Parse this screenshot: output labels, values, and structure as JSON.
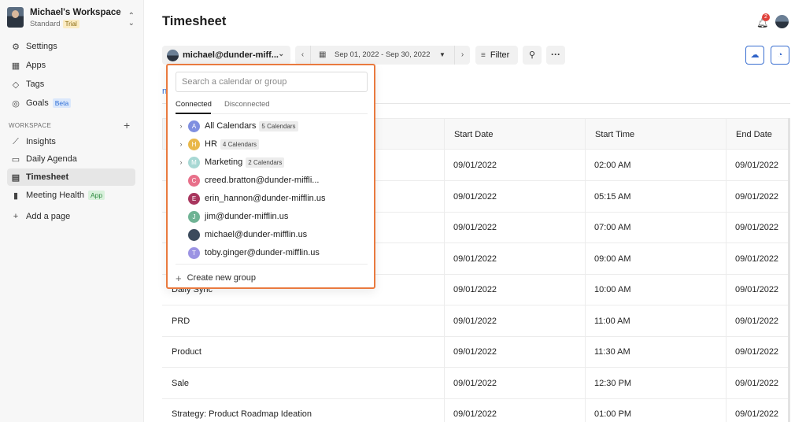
{
  "workspace": {
    "name": "Michael's Workspace",
    "plan": "Standard",
    "trial_badge": "Trial"
  },
  "sidebar": {
    "top_items": [
      {
        "label": "Settings",
        "icon": "gear-icon"
      },
      {
        "label": "Apps",
        "icon": "grid-icon"
      },
      {
        "label": "Tags",
        "icon": "tag-icon"
      },
      {
        "label": "Goals",
        "icon": "target-icon",
        "badge": "Beta"
      }
    ],
    "section_label": "WORKSPACE",
    "items": [
      {
        "label": "Insights",
        "icon": "chart-line-icon"
      },
      {
        "label": "Daily Agenda",
        "icon": "agenda-icon"
      },
      {
        "label": "Timesheet",
        "icon": "table-icon",
        "active": true
      },
      {
        "label": "Meeting Health",
        "icon": "bar-chart-icon",
        "badge": "App"
      },
      {
        "label": "Add a page",
        "icon": "plus-icon"
      }
    ]
  },
  "header": {
    "title": "Timesheet",
    "notification_count": "2"
  },
  "toolbar": {
    "user": "michael@dunder-miff...",
    "date_range": "Sep 01, 2022 - Sep 30, 2022",
    "filter_label": "Filter"
  },
  "tab_peek": "n",
  "table": {
    "columns": [
      "",
      "Start Date",
      "Start Time",
      "End Date"
    ],
    "rows": [
      {
        "name": "",
        "start_date": "09/01/2022",
        "start_time": "02:00 AM",
        "end_date": "09/01/2022"
      },
      {
        "name": "",
        "start_date": "09/01/2022",
        "start_time": "05:15 AM",
        "end_date": "09/01/2022"
      },
      {
        "name": "",
        "start_date": "09/01/2022",
        "start_time": "07:00 AM",
        "end_date": "09/01/2022"
      },
      {
        "name": "",
        "start_date": "09/01/2022",
        "start_time": "09:00 AM",
        "end_date": "09/01/2022"
      },
      {
        "name": "Daily Sync",
        "start_date": "09/01/2022",
        "start_time": "10:00 AM",
        "end_date": "09/01/2022"
      },
      {
        "name": "PRD",
        "start_date": "09/01/2022",
        "start_time": "11:00 AM",
        "end_date": "09/01/2022"
      },
      {
        "name": "Product",
        "start_date": "09/01/2022",
        "start_time": "11:30 AM",
        "end_date": "09/01/2022"
      },
      {
        "name": "Sale",
        "start_date": "09/01/2022",
        "start_time": "12:30 PM",
        "end_date": "09/01/2022"
      },
      {
        "name": "Strategy: Product Roadmap Ideation",
        "start_date": "09/01/2022",
        "start_time": "01:00 PM",
        "end_date": "09/01/2022"
      }
    ]
  },
  "dropdown": {
    "search_placeholder": "Search a calendar or group",
    "tabs": [
      "Connected",
      "Disconnected"
    ],
    "groups": [
      {
        "initial": "A",
        "label": "All Calendars",
        "count": "5 Calendars",
        "color": "#7f8fe0"
      },
      {
        "initial": "H",
        "label": "HR",
        "count": "4 Calendars",
        "color": "#e9b84a"
      },
      {
        "initial": "M",
        "label": "Marketing",
        "count": "2 Calendars",
        "color": "#a8d8d4"
      }
    ],
    "calendars": [
      {
        "initial": "C",
        "label": "creed.bratton@dunder-miffli...",
        "color": "#e8708a"
      },
      {
        "initial": "E",
        "label": "erin_hannon@dunder-mifflin.us",
        "color": "#a8365e"
      },
      {
        "initial": "J",
        "label": "jim@dunder-mifflin.us",
        "color": "#6fb394"
      },
      {
        "initial": "",
        "label": "michael@dunder-mifflin.us",
        "color": "#3b4a5c"
      },
      {
        "initial": "T",
        "label": "toby.ginger@dunder-mifflin.us",
        "color": "#9b93e3"
      }
    ],
    "create_label": "Create new group"
  }
}
